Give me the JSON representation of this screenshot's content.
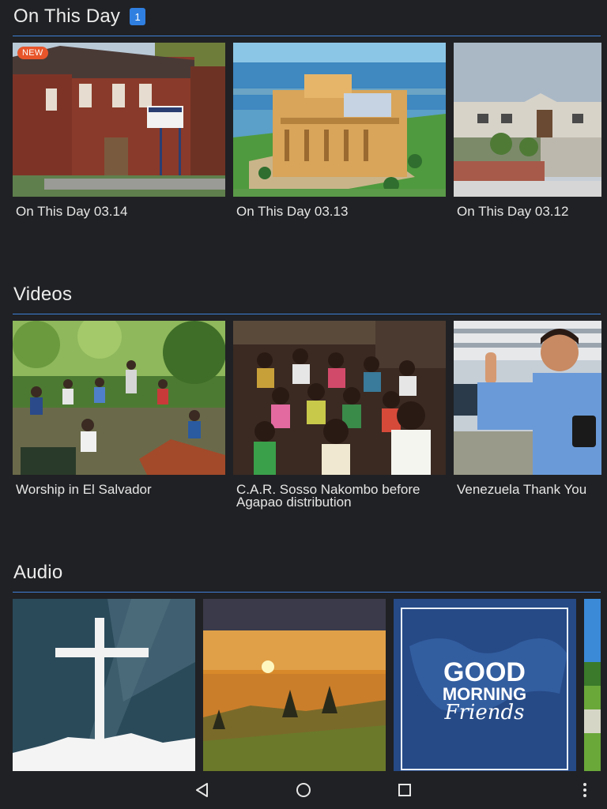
{
  "on_this_day": {
    "title": "On This Day",
    "badge_count": "1",
    "cards": [
      {
        "caption": "On This Day 03.14",
        "badge": "NEW"
      },
      {
        "caption": "On This Day 03.13"
      },
      {
        "caption": "On This Day 03.12"
      }
    ]
  },
  "videos": {
    "title": "Videos",
    "cards": [
      {
        "caption": "Worship in El Salvador"
      },
      {
        "caption": "C.A.R. Sosso Nakombo before Agapao distribution"
      },
      {
        "caption": "Venezuela Thank You"
      }
    ]
  },
  "audio": {
    "title": "Audio",
    "cards": [
      {
        "image": "cross-artwork"
      },
      {
        "image": "sunrise-landscape"
      },
      {
        "image": "good-morning-friends-artwork",
        "art_text_1": "GOOD",
        "art_text_2": "MORNING",
        "art_text_3": "Friends"
      },
      {
        "image": "partial-landscape"
      }
    ]
  },
  "navbar": {
    "icons": [
      "back-icon",
      "home-icon",
      "recents-icon",
      "overflow-menu-icon"
    ]
  },
  "colors": {
    "background": "#202124",
    "accent": "#3f80d8",
    "badge": "#2f7fe0",
    "new_badge": "#e8552a"
  }
}
